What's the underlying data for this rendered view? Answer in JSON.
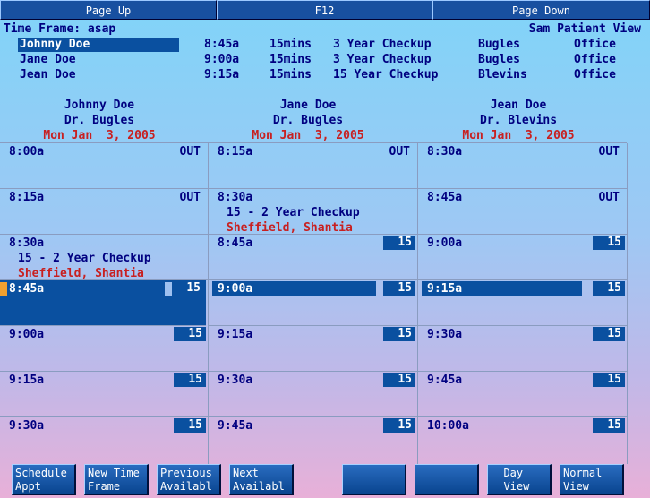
{
  "top_buttons": [
    "Page Up",
    "F12",
    "Page Down"
  ],
  "time_frame": "Time Frame: asap",
  "view_title": "Sam Patient View",
  "appointments": [
    {
      "name": "Johnny Doe",
      "time": "8:45a",
      "length": "15mins",
      "type": "3 Year Checkup",
      "doctor": "Bugles",
      "location": "Office"
    },
    {
      "name": "Jane Doe",
      "time": "9:00a",
      "length": "15mins",
      "type": "3 Year Checkup",
      "doctor": "Bugles",
      "location": "Office"
    },
    {
      "name": "Jean Doe",
      "time": "9:15a",
      "length": "15mins",
      "type": "15 Year Checkup",
      "doctor": "Blevins",
      "location": "Office"
    }
  ],
  "columns": [
    {
      "patient": "Johnny Doe",
      "doctor": "Dr. Bugles",
      "date": "Mon Jan  3, 2005"
    },
    {
      "patient": "Jane Doe",
      "doctor": "Dr. Bugles",
      "date": "Mon Jan  3, 2005"
    },
    {
      "patient": "Jean Doe",
      "doctor": "Dr. Blevins",
      "date": "Mon Jan  3, 2005"
    }
  ],
  "slots": [
    [
      {
        "time": "8:00a",
        "flag": "OUT"
      },
      {
        "time": "8:15a",
        "flag": "OUT"
      },
      {
        "time": "8:30a",
        "title": "15 - 2 Year Checkup",
        "patient": "Sheffield, Shantia"
      },
      {
        "time": "8:45a",
        "badge": "15"
      },
      {
        "time": "9:00a",
        "badge": "15"
      },
      {
        "time": "9:15a",
        "badge": "15"
      },
      {
        "time": "9:30a",
        "badge": "15"
      }
    ],
    [
      {
        "time": "8:15a",
        "flag": "OUT"
      },
      {
        "time": "8:30a",
        "title": "15 - 2 Year Checkup",
        "patient": "Sheffield, Shantia"
      },
      {
        "time": "8:45a",
        "badge": "15"
      },
      {
        "time": "9:00a",
        "badge": "15"
      },
      {
        "time": "9:15a",
        "badge": "15"
      },
      {
        "time": "9:30a",
        "badge": "15"
      },
      {
        "time": "9:45a",
        "badge": "15"
      }
    ],
    [
      {
        "time": "8:30a",
        "flag": "OUT"
      },
      {
        "time": "8:45a",
        "flag": "OUT"
      },
      {
        "time": "9:00a",
        "badge": "15"
      },
      {
        "time": "9:15a",
        "badge": "15"
      },
      {
        "time": "9:30a",
        "badge": "15"
      },
      {
        "time": "9:45a",
        "badge": "15"
      },
      {
        "time": "10:00a",
        "badge": "15"
      }
    ]
  ],
  "bottom_buttons": [
    "Schedule\nAppt",
    "New Time\nFrame",
    "Previous\nAvailabl",
    "Next\nAvailabl",
    "",
    "",
    "  Day\n  View",
    "Normal\nView"
  ],
  "colors": {
    "highlight": "#0a50a0",
    "accent_red": "#c82020",
    "text": "#000080"
  }
}
